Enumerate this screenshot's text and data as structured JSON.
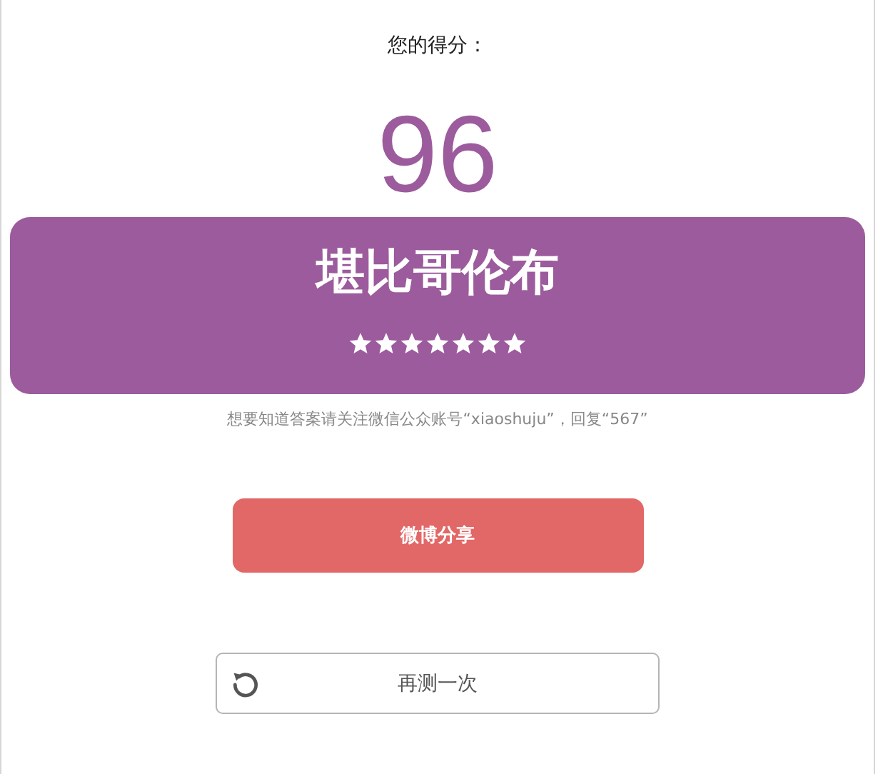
{
  "score_label": "您的得分：",
  "score": "96",
  "result": {
    "title": "堪比哥伦布",
    "stars": 7
  },
  "hint": "想要知道答案请关注微信公众账号“xiaoshuju”，回复“567”",
  "share_button": "微博分享",
  "retry_button": "再测一次"
}
